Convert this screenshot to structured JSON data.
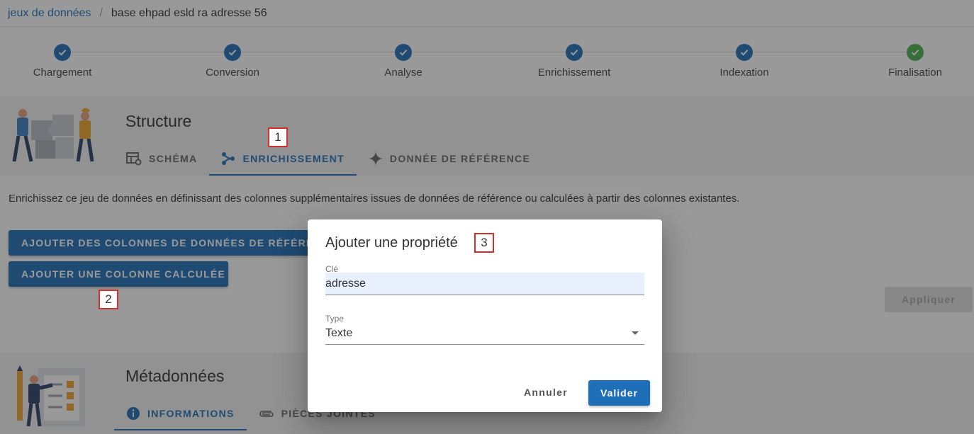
{
  "breadcrumb": {
    "root": "jeux de données",
    "separator": "/",
    "current": "base ehpad esld ra adresse 56"
  },
  "stepper": {
    "steps": [
      {
        "label": "Chargement",
        "status": "done",
        "color": "#1e6fb8"
      },
      {
        "label": "Conversion",
        "status": "done",
        "color": "#1e6fb8"
      },
      {
        "label": "Analyse",
        "status": "done",
        "color": "#1e6fb8"
      },
      {
        "label": "Enrichissement",
        "status": "done",
        "color": "#1e6fb8"
      },
      {
        "label": "Indexation",
        "status": "done",
        "color": "#1e6fb8"
      },
      {
        "label": "Finalisation",
        "status": "complete",
        "color": "#4caf50"
      }
    ]
  },
  "structure": {
    "title": "Structure",
    "tabs": [
      {
        "label": "Schéma",
        "icon": "table-settings-icon",
        "active": false
      },
      {
        "label": "Enrichissement",
        "icon": "graph-branch-icon",
        "active": true
      },
      {
        "label": "Donnée de référence",
        "icon": "star-four-point-icon",
        "active": false
      }
    ],
    "description": "Enrichissez ce jeu de données en définissant des colonnes supplémentaires issues de données de référence ou calculées à partir des colonnes existantes.",
    "buttons": {
      "add_reference_columns": "Ajouter des colonnes de données de référence",
      "add_computed_column": "Ajouter une colonne calculée",
      "apply": "Appliquer"
    }
  },
  "metadata": {
    "title": "Métadonnées",
    "tabs": [
      {
        "label": "Informations",
        "icon": "info-icon",
        "active": true
      },
      {
        "label": "Pièces jointes",
        "icon": "paperclip-icon",
        "active": false
      }
    ]
  },
  "markers": [
    "1",
    "2",
    "3"
  ],
  "dialog": {
    "title": "Ajouter une propriété",
    "key_label": "Clé",
    "key_value": "adresse",
    "type_label": "Type",
    "type_value": "Texte",
    "cancel": "Annuler",
    "submit": "Valider"
  },
  "colors": {
    "primary": "#1e6fb8",
    "success": "#4caf50",
    "marker_border": "#d32f2f"
  }
}
